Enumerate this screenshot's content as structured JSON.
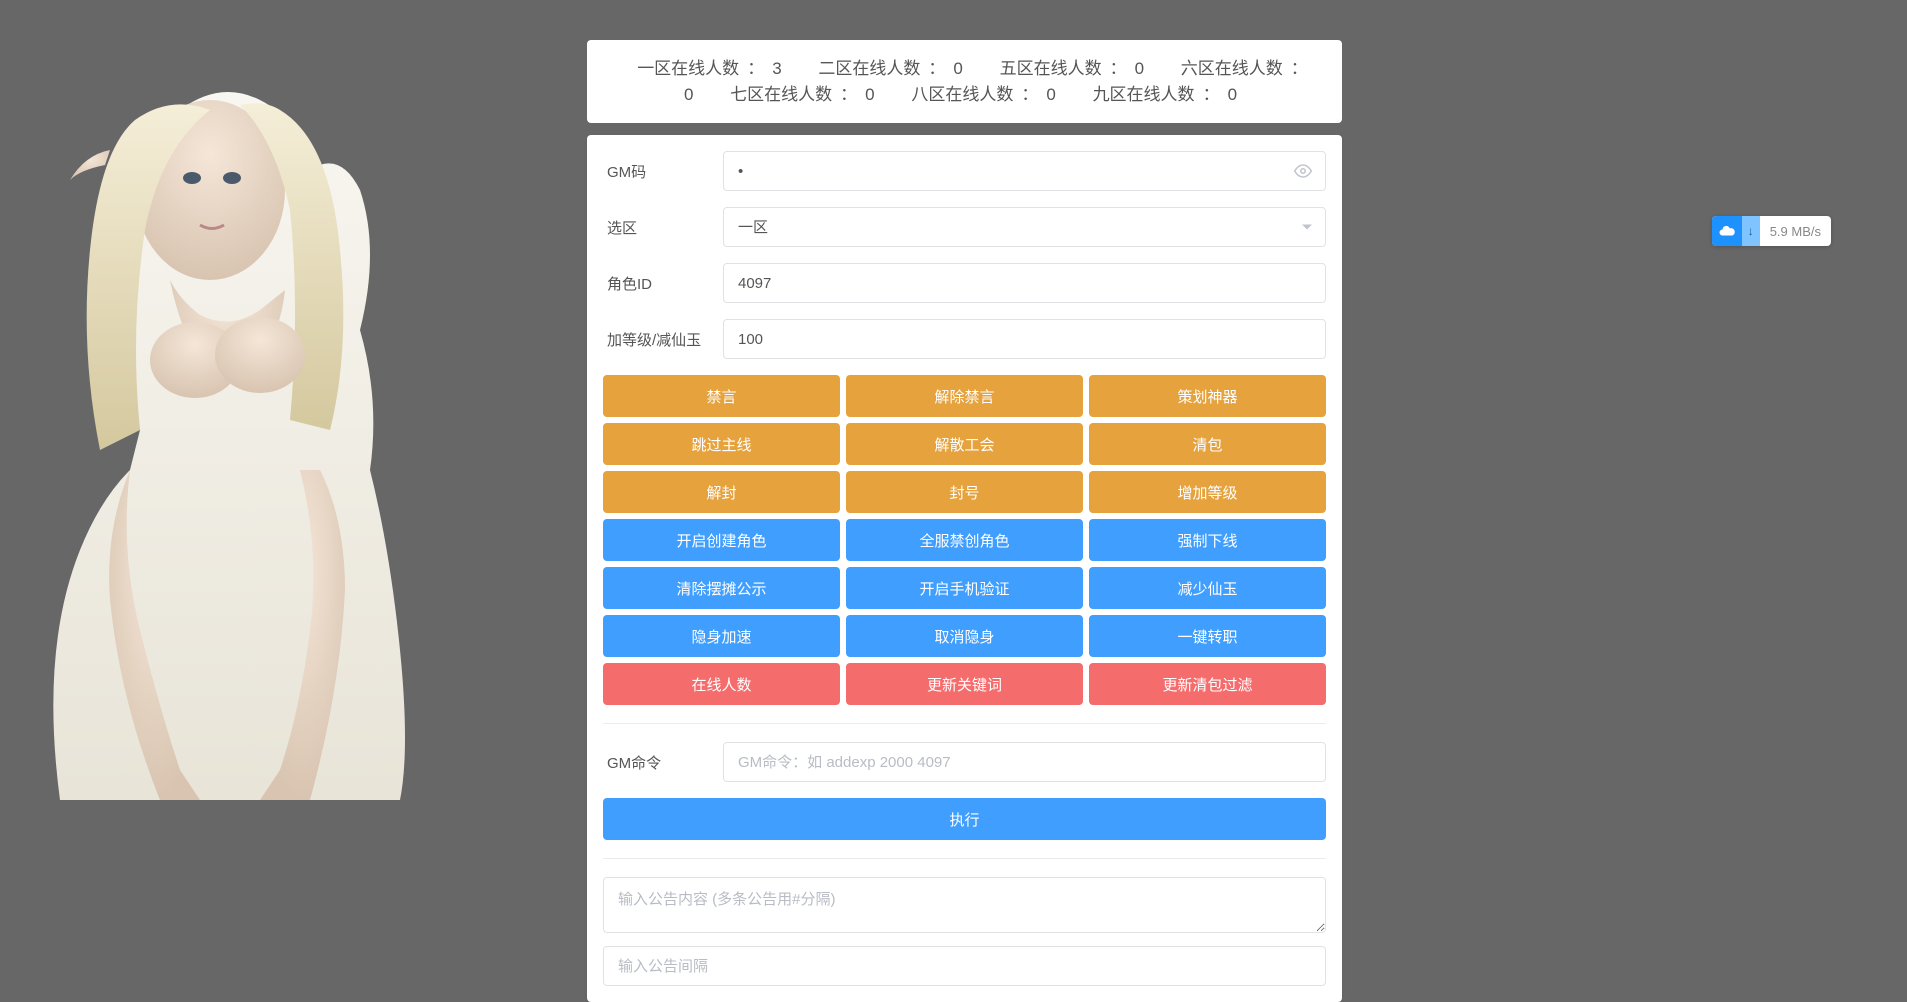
{
  "status": {
    "zones": [
      {
        "label": "一区在线人数",
        "count": "3"
      },
      {
        "label": "二区在线人数",
        "count": "0"
      },
      {
        "label": "五区在线人数",
        "count": "0"
      },
      {
        "label": "六区在线人数",
        "count": "0"
      },
      {
        "label": "七区在线人数",
        "count": "0"
      },
      {
        "label": "八区在线人数",
        "count": "0"
      },
      {
        "label": "九区在线人数",
        "count": "0"
      }
    ]
  },
  "form": {
    "gm_code_label": "GM码",
    "gm_code_value": "•",
    "zone_label": "选区",
    "zone_selected": "一区",
    "role_id_label": "角色ID",
    "role_id_value": "4097",
    "level_label": "加等级/减仙玉",
    "level_value": "100",
    "gm_cmd_label": "GM命令",
    "gm_cmd_placeholder": "GM命令：如 addexp 2000 4097",
    "execute_label": "执行",
    "notice_placeholder": "输入公告内容 (多条公告用#分隔)",
    "interval_placeholder": "输入公告间隔"
  },
  "buttons": {
    "orange": [
      [
        "禁言",
        "解除禁言",
        "策划神器"
      ],
      [
        "跳过主线",
        "解散工会",
        "清包"
      ],
      [
        "解封",
        "封号",
        "增加等级"
      ]
    ],
    "blue": [
      [
        "开启创建角色",
        "全服禁创角色",
        "强制下线"
      ],
      [
        "清除摆摊公示",
        "开启手机验证",
        "减少仙玉"
      ],
      [
        "隐身加速",
        "取消隐身",
        "一键转职"
      ]
    ],
    "red": [
      [
        "在线人数",
        "更新关键词",
        "更新清包过滤"
      ]
    ]
  },
  "download_widget": {
    "speed": "5.9 MB/s",
    "arrow": "↓"
  }
}
